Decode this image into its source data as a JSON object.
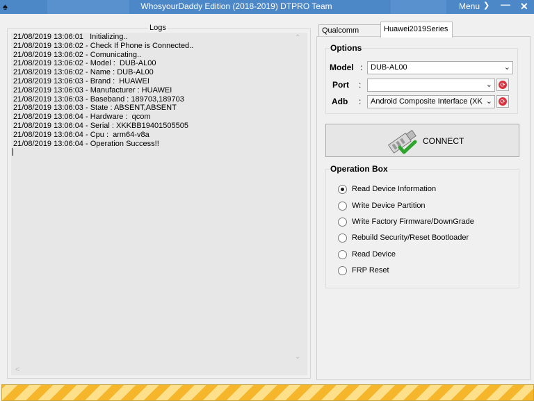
{
  "window": {
    "title": "WhosyourDaddy Edition (2018-2019) DTPRO Team",
    "menu_label": "Menu",
    "icons": [
      "app-icon",
      "chevron-down-icon",
      "minimize-icon",
      "close-icon"
    ]
  },
  "logs": {
    "legend": "Logs",
    "lines": [
      "21/08/2019 13:06:01   Initializing..",
      "21/08/2019 13:06:02 - Check If Phone is Connected..",
      "21/08/2019 13:06:02 - Comunicating..",
      "21/08/2019 13:06:02 - Model :  DUB-AL00",
      "21/08/2019 13:06:02 - Name : DUB-AL00",
      "21/08/2019 13:06:03 - Brand :  HUAWEI",
      "21/08/2019 13:06:03 - Manufacturer : HUAWEI",
      "21/08/2019 13:06:03 - Baseband : 189703,189703",
      "21/08/2019 13:06:03 - State : ABSENT,ABSENT",
      "21/08/2019 13:06:04 - Hardware :  qcom",
      "21/08/2019 13:06:04 - Serial : XKKBB19401505505",
      "21/08/2019 13:06:04 - Cpu :  arm64-v8a",
      "21/08/2019 13:06:04 - Operation Success!!"
    ]
  },
  "tabs": [
    {
      "label": "Qualcomm Flash",
      "active": false
    },
    {
      "label": "Huawei2019Series",
      "active": true
    }
  ],
  "options": {
    "legend": "Options",
    "model_label": "Model",
    "model_value": "DUB-AL00",
    "port_label": "Port",
    "port_value": "",
    "adb_label": "Adb",
    "adb_value": "Android Composite Interface (XK",
    "colon": ":"
  },
  "connect": {
    "label": "CONNECT"
  },
  "operation_box": {
    "legend": "Operation Box",
    "items": [
      {
        "label": "Read Device Information",
        "checked": true
      },
      {
        "label": "Write Device Partition",
        "checked": false
      },
      {
        "label": "Write Factory Firmware/DownGrade",
        "checked": false
      },
      {
        "label": "Rebuild Security/Reset Bootloader",
        "checked": false
      },
      {
        "label": "Read Device",
        "checked": false
      },
      {
        "label": "FRP Reset",
        "checked": false
      }
    ]
  },
  "colors": {
    "titlebar": "#4c87c8",
    "progress_stripe_a": "#f5b62b",
    "progress_stripe_b": "#ffe08a",
    "refresh_red": "#d9303c",
    "check_green": "#2fa52f"
  },
  "progress": {
    "fraction": 1.0
  }
}
